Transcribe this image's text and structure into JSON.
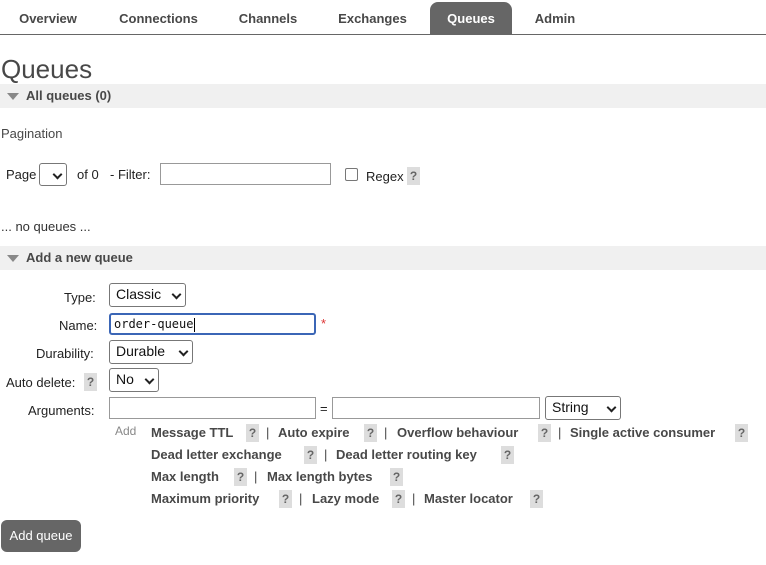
{
  "tabs": [
    "Overview",
    "Connections",
    "Channels",
    "Exchanges",
    "Queues",
    "Admin"
  ],
  "page_title": "Queues",
  "all_queues": {
    "label": "All queues (0)"
  },
  "pagination": {
    "label": "Pagination",
    "page_label": "Page",
    "of_label": "of 0",
    "filter_label": "- Filter:",
    "filter_value": "",
    "regex_label": "Regex",
    "regex_checked": false,
    "help": "?"
  },
  "no_queues_text": "... no queues ...",
  "add_queue": {
    "header": "Add a new queue",
    "type_label": "Type:",
    "type_value": "Classic",
    "name_label": "Name:",
    "name_value": "order-queue",
    "required_mark": "*",
    "durability_label": "Durability:",
    "durability_value": "Durable",
    "auto_delete_label": "Auto delete:",
    "auto_delete_value": "No",
    "arguments_label": "Arguments:",
    "equals": "=",
    "arg_type_value": "String",
    "add_label": "Add",
    "arg_links": {
      "message_ttl": "Message TTL",
      "auto_expire": "Auto expire",
      "overflow_behaviour": "Overflow behaviour",
      "single_active_consumer": "Single active consumer",
      "dead_letter_exchange": "Dead letter exchange",
      "dead_letter_routing_key": "Dead letter routing key",
      "max_length": "Max length",
      "max_length_bytes": "Max length bytes",
      "maximum_priority": "Maximum priority",
      "lazy_mode": "Lazy mode",
      "master_locator": "Master locator"
    },
    "separator": "|",
    "button_label": "Add queue"
  },
  "colors": {
    "active_tab": "#666666",
    "focus_border": "#3b66b6",
    "required": "#dd3333"
  }
}
